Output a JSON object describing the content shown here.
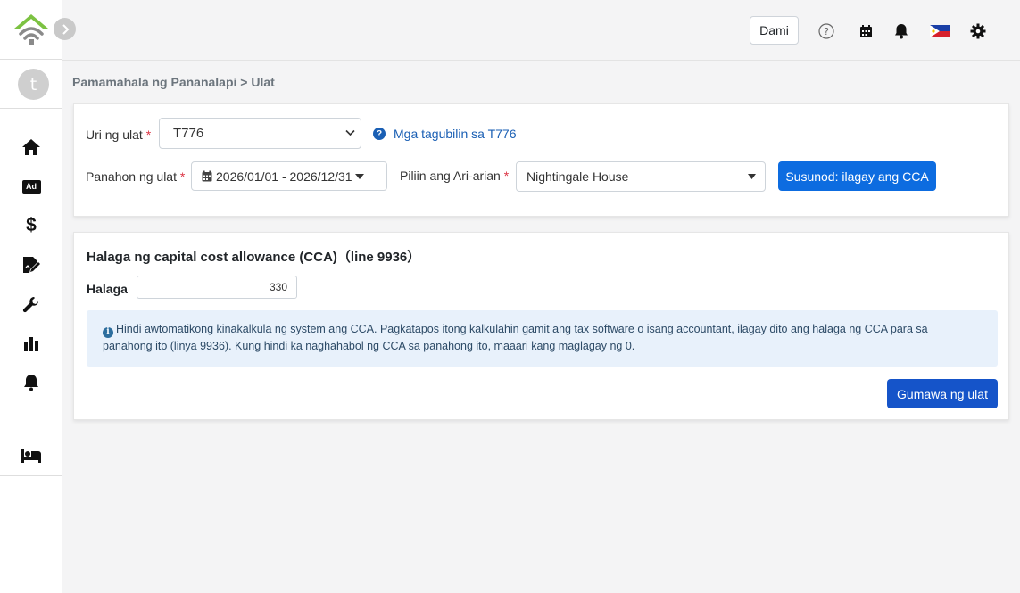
{
  "sidebar": {
    "avatar_letter": "t",
    "items": [
      {
        "name": "home-icon"
      },
      {
        "name": "ad-icon",
        "label": "Ad"
      },
      {
        "name": "dollar-icon",
        "label": "$"
      },
      {
        "name": "contract-icon"
      },
      {
        "name": "wrench-icon"
      },
      {
        "name": "bar-chart-icon"
      },
      {
        "name": "bell-icon"
      },
      {
        "name": "bed-icon"
      }
    ]
  },
  "topbar": {
    "more_label": "Dami",
    "icons": [
      "help-icon",
      "calendar-icon",
      "bell-icon",
      "philippines-flag-icon",
      "gear-icon"
    ]
  },
  "breadcrumb": "Pamamahala ng Pananalapi > Ulat",
  "filters": {
    "report_type_label": "Uri ng ulat",
    "report_type_value": "T776",
    "instructions_link": "Mga tagubilin sa T776",
    "period_label": "Panahon ng ulat",
    "period_value": "2026/01/01 - 2026/12/31",
    "property_label": "Piliin ang Ari-arian",
    "property_value": "Nightingale House",
    "next_button": "Susunod: ilagay ang CCA"
  },
  "cca": {
    "title": "Halaga ng capital cost allowance (CCA)（line 9936）",
    "amount_label": "Halaga",
    "amount_value": "330",
    "info_text": "Hindi awtomatikong kinakalkula ng system ang CCA. Pagkatapos itong kalkulahin gamit ang tax software o isang accountant, ilagay dito ang halaga ng CCA para sa panahong ito (linya 9936). Kung hindi ka naghahabol ng CCA sa panahong ito, maaari kang maglagay ng 0.",
    "generate_button": "Gumawa ng ulat"
  },
  "colors": {
    "primary": "#0d6ce0",
    "logo_green": "#7cc242",
    "logo_gray": "#8a8a8a",
    "required": "#dc3545",
    "info_bg": "#e8f1fb"
  }
}
